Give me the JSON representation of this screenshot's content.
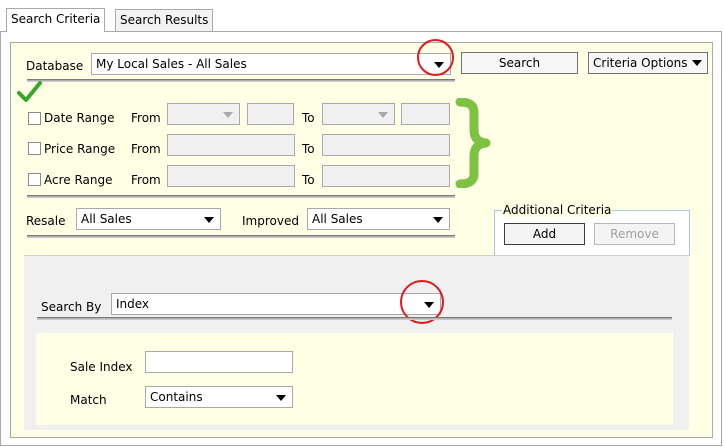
{
  "tabs": [
    {
      "label": "Search Criteria",
      "active": true
    },
    {
      "label": "Search Results",
      "active": false
    }
  ],
  "database": {
    "label": "Database",
    "value": "My Local Sales - All Sales"
  },
  "buttons": {
    "search": "Search",
    "criteria_options": "Criteria Options"
  },
  "ranges": [
    {
      "label": "Date Range",
      "from": "From",
      "to": "To",
      "checked": false
    },
    {
      "label": "Price Range",
      "from": "From",
      "to": "To",
      "checked": false
    },
    {
      "label": "Acre Range",
      "from": "From",
      "to": "To",
      "checked": false
    }
  ],
  "resale": {
    "label": "Resale",
    "value": "All Sales"
  },
  "improved": {
    "label": "Improved",
    "value": "All Sales"
  },
  "additional_criteria": {
    "legend": "Additional Criteria",
    "add": "Add",
    "remove": "Remove"
  },
  "search_by": {
    "label": "Search By",
    "value": "Index"
  },
  "sale_index": {
    "label": "Sale Index",
    "value": ""
  },
  "match": {
    "label": "Match",
    "value": "Contains"
  },
  "colors": {
    "panel_bg": "#ffffe6",
    "highlight": "#e0191c",
    "brace": "#7dc243",
    "check": "#3aa52a"
  }
}
